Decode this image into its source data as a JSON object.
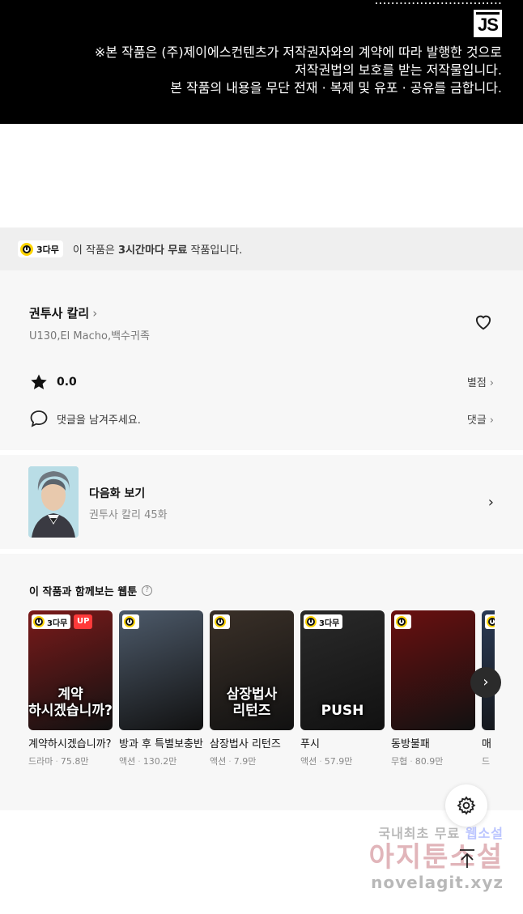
{
  "banner": {
    "cut_line": "...............................",
    "logo_text": "JS",
    "notice_lines": [
      "※본 작품은 (주)제이에스컨텐츠가 저작권자와의 계약에 따라 발행한 것으로",
      "저작권법의 보호를 받는 저작물입니다.",
      "본 작품의 내용을 무단 전재 · 복제 및 유포 · 공유를 금합니다."
    ]
  },
  "promo": {
    "badge": "3다무",
    "text_pre": "이 작품은 ",
    "text_bold": "3시간마다 무료",
    "text_post": " 작품입니다."
  },
  "work": {
    "title": "권투사 칼리",
    "authors": "U130,El Macho,백수귀족",
    "rating": "0.0",
    "rating_link": "별점",
    "comment_prompt": "댓글을 남겨주세요.",
    "comment_link": "댓글"
  },
  "next_episode": {
    "label": "다음화 보기",
    "subtitle": "권투사 칼리 45화"
  },
  "recommendations": {
    "title": "이 작품과 함께보는 웹툰",
    "items": [
      {
        "name": "계약하시겠습니까?",
        "genre": "드라마",
        "views": "75.8만",
        "badge": "3다무",
        "up": "UP",
        "cover_text": "계약\n하시겠습니까?",
        "cover_color": "#7a1a1a"
      },
      {
        "name": "방과 후 특별보충반",
        "genre": "액션",
        "views": "130.2만",
        "badge": "",
        "up": "",
        "cover_text": "",
        "cover_color": "#4d5a6a"
      },
      {
        "name": "삼장법사 리턴즈",
        "genre": "액션",
        "views": "7.9만",
        "badge": "",
        "up": "",
        "cover_text": "삼장법사\n리턴즈",
        "cover_color": "#3a3028"
      },
      {
        "name": "푸시",
        "genre": "액션",
        "views": "57.9만",
        "badge": "3다무",
        "up": "",
        "cover_text": "PUSH",
        "cover_color": "#2a2a2a"
      },
      {
        "name": "동방불패",
        "genre": "무협",
        "views": "80.9만",
        "badge": "",
        "up": "",
        "cover_text": "",
        "cover_color": "#6a1010"
      },
      {
        "name": "매",
        "genre": "드",
        "views": "",
        "badge": "",
        "up": "",
        "cover_text": "",
        "cover_color": "#2a3a55"
      }
    ]
  },
  "watermark": {
    "line1_pre": "국내최초 무료 ",
    "line1_hl": "웹소설",
    "line2": "아지툰소설",
    "line3": "novelagit.xyz"
  },
  "colors": {
    "accent_yellow": "#ffd400",
    "up_red": "#ff3a3a"
  }
}
